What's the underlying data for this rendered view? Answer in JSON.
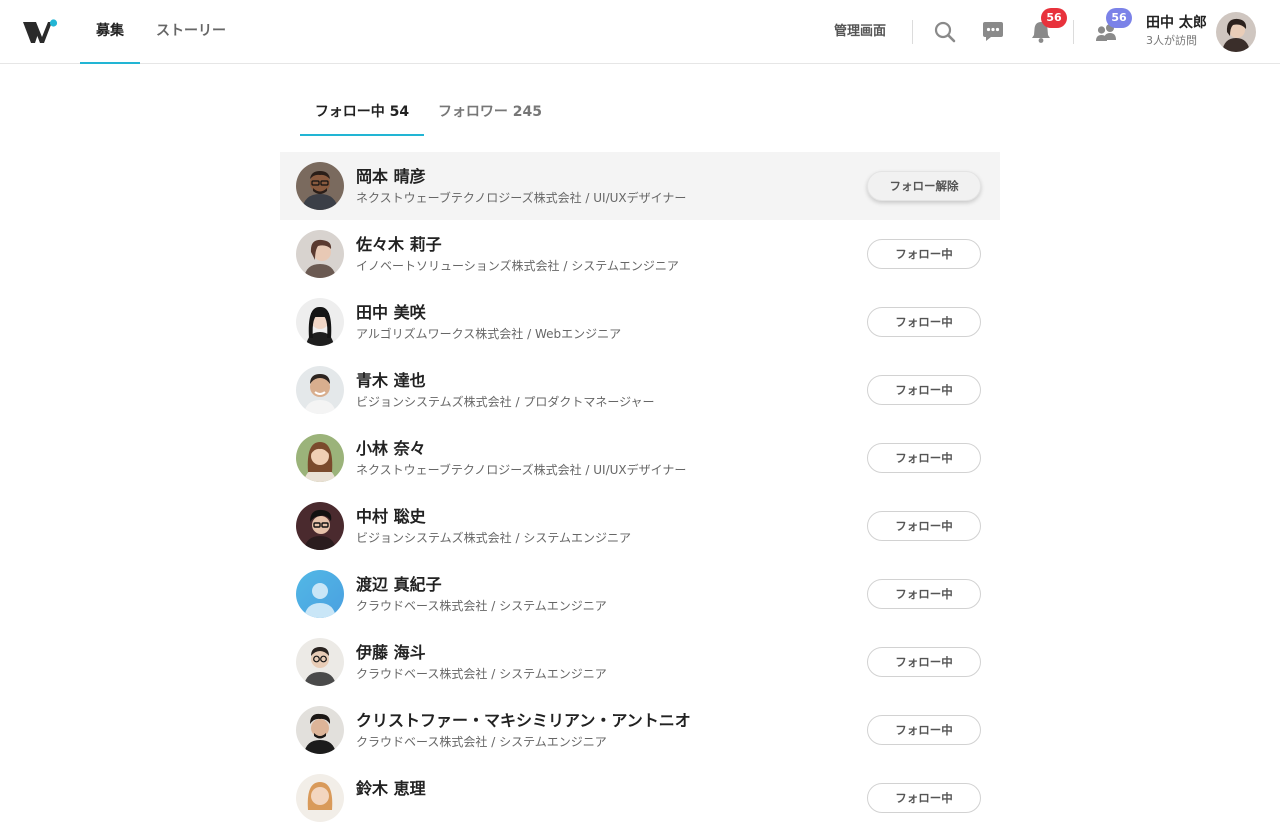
{
  "header": {
    "nav": {
      "recruit": "募集",
      "stories": "ストーリー"
    },
    "admin_label": "管理画面",
    "notifications_count": "56",
    "visitors_count": "56",
    "user": {
      "name": "田中 太郎",
      "sub": "3人が訪問"
    }
  },
  "tabs": {
    "following": "フォロー中 54",
    "followers": "フォロワー 245"
  },
  "colors": {
    "accent": "#22b5d4",
    "badge_red": "#e8323c",
    "badge_purple": "#7b82e8"
  },
  "list": [
    {
      "name": "岡本 晴彦",
      "meta": "ネクストウェーブテクノロジーズ株式会社 / UI/UXデザイナー",
      "button": "フォロー解除",
      "hover": true
    },
    {
      "name": "佐々木 莉子",
      "meta": "イノベートソリューションズ株式会社 / システムエンジニア",
      "button": "フォロー中"
    },
    {
      "name": "田中 美咲",
      "meta": "アルゴリズムワークス株式会社 / Webエンジニア",
      "button": "フォロー中"
    },
    {
      "name": "青木 達也",
      "meta": "ビジョンシステムズ株式会社 / プロダクトマネージャー",
      "button": "フォロー中"
    },
    {
      "name": "小林 奈々",
      "meta": "ネクストウェーブテクノロジーズ株式会社 / UI/UXデザイナー",
      "button": "フォロー中"
    },
    {
      "name": "中村 聡史",
      "meta": "ビジョンシステムズ株式会社 / システムエンジニア",
      "button": "フォロー中"
    },
    {
      "name": "渡辺 真紀子",
      "meta": "クラウドベース株式会社 / システムエンジニア",
      "button": "フォロー中"
    },
    {
      "name": "伊藤 海斗",
      "meta": "クラウドベース株式会社 / システムエンジニア",
      "button": "フォロー中"
    },
    {
      "name": "クリストファー・マキシミリアン・アントニオ",
      "meta": "クラウドベース株式会社 / システムエンジニア",
      "button": "フォロー中"
    },
    {
      "name": "鈴木 恵理",
      "meta": "",
      "button": "フォロー中"
    }
  ]
}
